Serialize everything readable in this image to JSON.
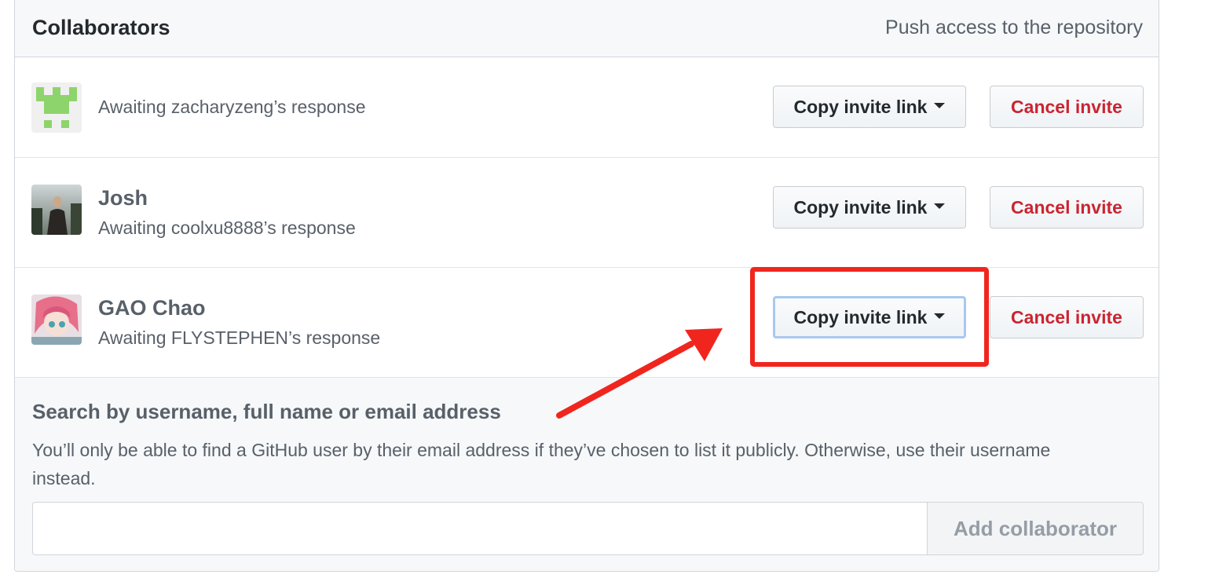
{
  "header": {
    "title": "Collaborators",
    "subtitle": "Push access to the repository"
  },
  "invites": [
    {
      "name": "",
      "status": "Awaiting zacharyzeng’s response",
      "copy_label": "Copy invite link",
      "cancel_label": "Cancel invite"
    },
    {
      "name": "Josh",
      "status": "Awaiting coolxu8888’s response",
      "copy_label": "Copy invite link",
      "cancel_label": "Cancel invite"
    },
    {
      "name": "GAO Chao",
      "status": "Awaiting FLYSTEPHEN’s response",
      "copy_label": "Copy invite link",
      "cancel_label": "Cancel invite"
    }
  ],
  "search": {
    "title": "Search by username, full name or email address",
    "note": "You’ll only be able to find a GitHub user by their email address if they’ve chosen to list it publicly. Otherwise, use their username instead.",
    "input_value": "",
    "add_label": "Add collaborator"
  },
  "colors": {
    "danger": "#cb2431",
    "annotation": "#f0261e",
    "identicon": "#8ed46c"
  },
  "icons": {
    "caret": "triangle-down-icon"
  }
}
